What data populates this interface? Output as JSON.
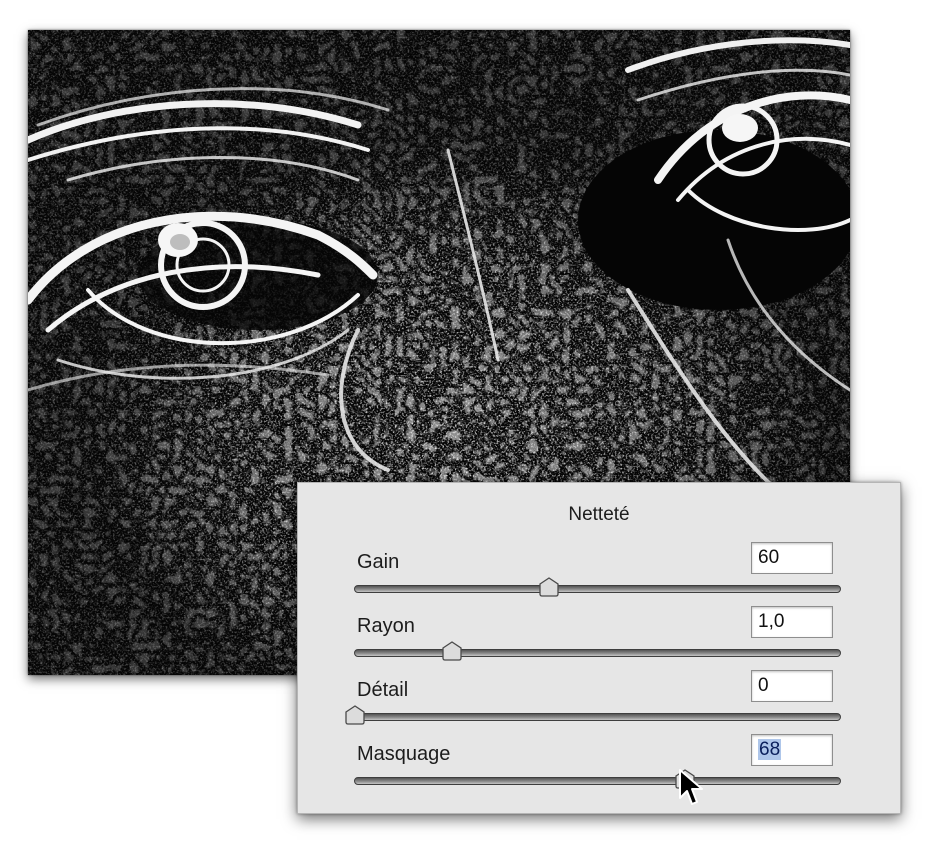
{
  "panel": {
    "title": "Netteté",
    "sliders": [
      {
        "label": "Gain",
        "value": "60",
        "level": 0.4,
        "selected": false
      },
      {
        "label": "Rayon",
        "value": "1,0",
        "level": 0.2,
        "selected": false
      },
      {
        "label": "Détail",
        "value": "0",
        "level": 0.0,
        "selected": false
      },
      {
        "label": "Masquage",
        "value": "68",
        "level": 0.68,
        "selected": true
      }
    ]
  },
  "icons": {
    "cursor": "arrow-cursor-icon",
    "thumb": "slider-thumb-icon"
  },
  "colors": {
    "panel_bg": "#e6e6e6",
    "selection": "#aec6ea",
    "photo_bg": "#050505"
  }
}
